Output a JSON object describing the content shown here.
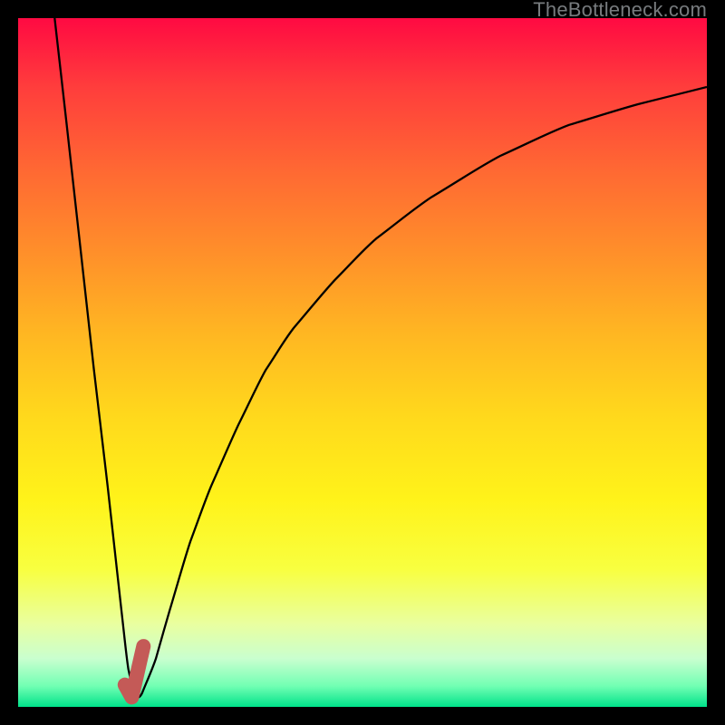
{
  "watermark": "TheBottleneck.com",
  "chart_data": {
    "type": "line",
    "title": "",
    "xlabel": "",
    "ylabel": "",
    "xlim": [
      0,
      100
    ],
    "ylim": [
      0,
      100
    ],
    "grid": false,
    "legend": false,
    "background_gradient": {
      "top": "#ff0a42",
      "mid": "#fff31a",
      "bottom": "#00e28a"
    },
    "series": [
      {
        "name": "bottleneck-curve",
        "type": "line",
        "x": [
          5.3,
          7,
          9,
          11,
          13,
          15,
          16,
          17,
          18,
          20,
          22,
          25,
          28,
          32,
          36,
          40,
          46,
          52,
          60,
          70,
          80,
          90,
          100
        ],
        "y": [
          100,
          85,
          67,
          49,
          32,
          14,
          5.5,
          1.2,
          2.0,
          7,
          14,
          24,
          32,
          41,
          49,
          55,
          62,
          68,
          74,
          80,
          84.5,
          87.5,
          90
        ]
      },
      {
        "name": "optimum-marker",
        "type": "marker",
        "color": "#c45a57",
        "x": [
          15.5,
          16.5,
          18.2
        ],
        "y": [
          3.2,
          1.4,
          8.8
        ]
      }
    ],
    "optimum_x": 16.5
  }
}
